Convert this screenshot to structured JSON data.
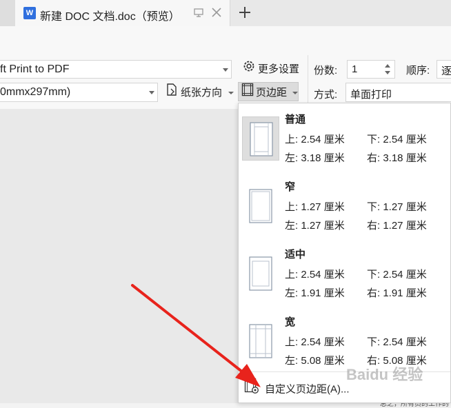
{
  "tab": {
    "title": "新建 DOC 文档.doc（预览）",
    "doc_icon": "W"
  },
  "icons": {
    "doc": "wps-writer-icon",
    "pin": "pin-window-icon",
    "close": "close-icon",
    "new_tab": "plus-icon",
    "settings": "gear-icon",
    "orientation": "paper-orientation-icon",
    "margins": "page-margins-icon",
    "custom_margins": "custom-margins-icon",
    "arrow": "red-arrow-annotation"
  },
  "toolbar": {
    "printer_value": "ft Print to PDF",
    "paper_value": "0mmx297mm)",
    "more_settings_label": "更多设置",
    "orientation_label": "纸张方向",
    "margins_label": "页边距",
    "copies_label": "份数:",
    "copies_value": "1",
    "order_label": "顺序:",
    "order_value": "逐",
    "mode_label": "方式:",
    "mode_value": "单面打印"
  },
  "margins_menu": {
    "presets": [
      {
        "name": "普通",
        "top": "上: 2.54 厘米",
        "bottom": "下: 2.54 厘米",
        "left": "左: 3.18 厘米",
        "right": "右: 3.18 厘米",
        "selected": true
      },
      {
        "name": "窄",
        "top": "上: 1.27 厘米",
        "bottom": "下: 1.27 厘米",
        "left": "左: 1.27 厘米",
        "right": "右: 1.27 厘米",
        "selected": false
      },
      {
        "name": "适中",
        "top": "上: 2.54 厘米",
        "bottom": "下: 2.54 厘米",
        "left": "左: 1.91 厘米",
        "right": "右: 1.91 厘米",
        "selected": false
      },
      {
        "name": "宽",
        "top": "上: 2.54 厘米",
        "bottom": "下: 2.54 厘米",
        "left": "左: 5.08 厘米",
        "right": "右: 5.08 厘米",
        "selected": false
      }
    ],
    "custom_label": "自定义页边距(A)..."
  },
  "background": {
    "doc_snippet": "总之，所有员的工作的"
  },
  "watermark": {
    "text": "Baidu 经验"
  },
  "colors": {
    "accent_blue": "#2f6fde",
    "arrow_red": "#e8231c",
    "selected_bg": "#dedede"
  }
}
